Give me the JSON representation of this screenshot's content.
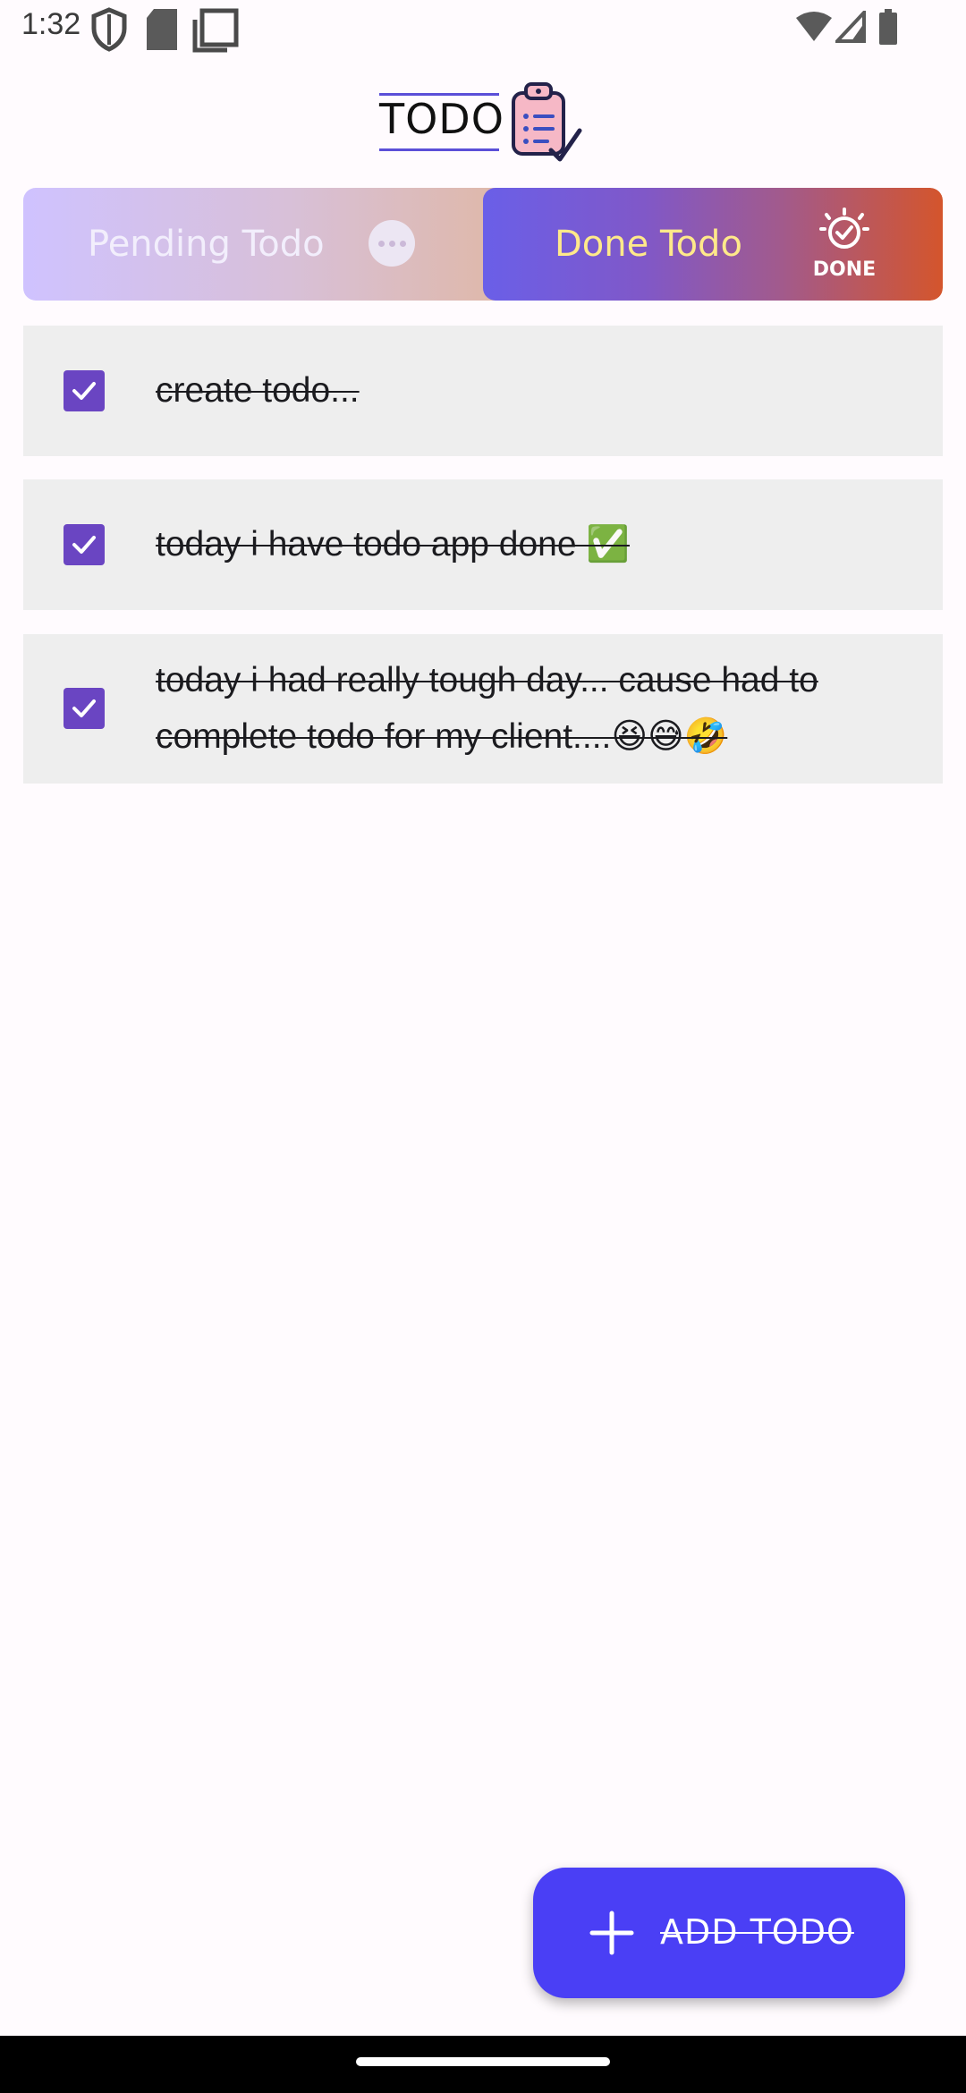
{
  "status_bar": {
    "time": "1:32",
    "icons": [
      "shield-icon",
      "sd-card-icon",
      "screenshot-icon",
      "wifi-icon",
      "signal-icon",
      "battery-icon"
    ]
  },
  "header": {
    "logo_text": "TODO",
    "logo_icon": "clipboard-list-icon"
  },
  "tabs": [
    {
      "label": "Pending Todo",
      "icon": "more-dots-icon",
      "selected": false
    },
    {
      "label": "Done Todo",
      "icon": "done-badge-icon",
      "icon_text": "DONE",
      "selected": true
    }
  ],
  "todos": [
    {
      "text": "create todo...",
      "checked": true
    },
    {
      "text": "today i have  todo app done ✅",
      "checked": true
    },
    {
      "text": "today i had really tough day... cause had to complete todo for my client....😆😅🤣",
      "checked": true
    }
  ],
  "fab": {
    "label": "ADD TODO",
    "icon": "plus-icon"
  },
  "colors": {
    "accent": "#4a3ff5",
    "checkbox": "#6a45c2",
    "done_tab_label": "#ffe98a",
    "item_bg": "#eeeeee"
  }
}
